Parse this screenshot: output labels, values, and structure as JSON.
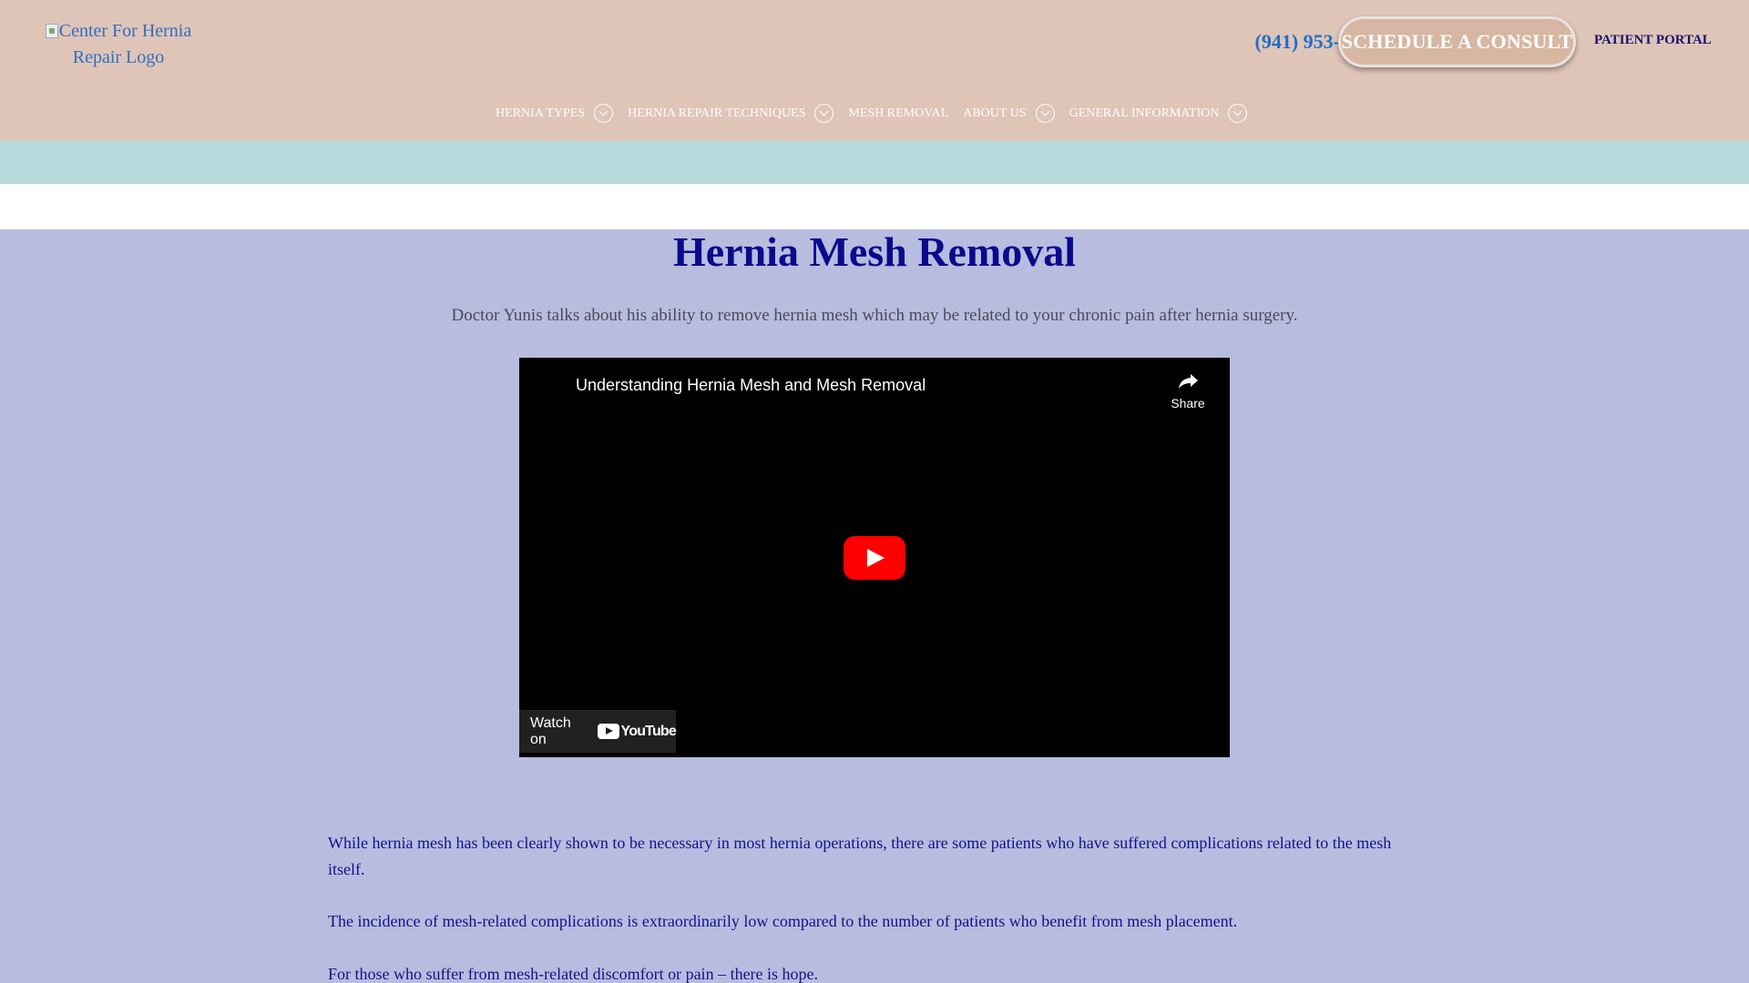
{
  "header": {
    "logo_alt": "Center For Hernia Repair Logo",
    "phone": "(941) 953-5917",
    "consult_label": "SCHEDULE A CONSULT",
    "portal_label": "PATIENT PORTAL"
  },
  "nav": {
    "items": [
      {
        "label": "HERNIA TYPES",
        "has_dropdown": true
      },
      {
        "label": "HERNIA REPAIR TECHNIQUES",
        "has_dropdown": true
      },
      {
        "label": "MESH REMOVAL",
        "has_dropdown": false
      },
      {
        "label": "ABOUT US",
        "has_dropdown": true
      },
      {
        "label": "GENERAL INFORMATION",
        "has_dropdown": true
      }
    ]
  },
  "main": {
    "title": "Hernia Mesh Removal",
    "subtitle": "Doctor Yunis talks about his ability to remove hernia mesh which may be related to your chronic pain after hernia surgery.",
    "video": {
      "title": "Understanding Hernia Mesh and Mesh Removal",
      "share_label": "Share",
      "watch_on_label": "Watch on",
      "brand": "YouTube"
    },
    "paragraphs": [
      "While hernia mesh has been clearly shown to be necessary in most hernia operations, there are some patients who have suffered complications related to the mesh itself.",
      "The incidence of mesh-related complications is extraordinarily low compared to the number of patients who benefit from mesh placement.",
      "For those who suffer from mesh-related discomfort or pain – there is hope."
    ]
  },
  "colors": {
    "header_bg": "#dfc4b8",
    "teal_bar": "#b6d9db",
    "page_bg": "#b8bcdf",
    "title": "#0a0a8c",
    "body_text": "#12128a",
    "phone": "#1f6fc6",
    "yt_red": "#ff0000"
  }
}
